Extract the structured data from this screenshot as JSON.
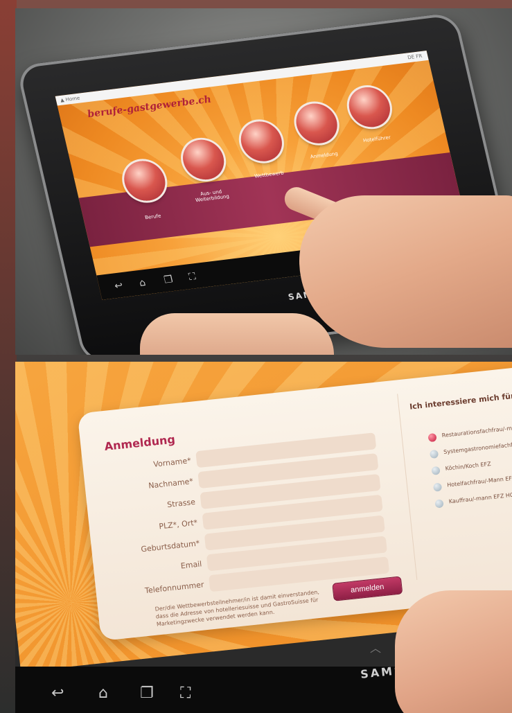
{
  "top_screen": {
    "status_left": "▲ Home",
    "status_right": "DE  FR",
    "logo": "berufe-gastgewerbe.ch",
    "menu": [
      {
        "label": "Berufe"
      },
      {
        "label": "Aus- und Weiterbildung"
      },
      {
        "label": "Wettbewerb"
      },
      {
        "label": "Anmeldung"
      },
      {
        "label": "Hotelführer"
      }
    ],
    "brand": "SAMSUNG"
  },
  "bottom_screen": {
    "form_title": "Anmeldung",
    "fields": [
      {
        "label": "Vorname*",
        "value": ""
      },
      {
        "label": "Nachname*",
        "value": ""
      },
      {
        "label": "Strasse",
        "value": ""
      },
      {
        "label": "PLZ*, Ort*",
        "value": ""
      },
      {
        "label": "Geburtsdatum*",
        "value": ""
      },
      {
        "label": "Email",
        "value": ""
      },
      {
        "label": "Telefonnummer",
        "value": ""
      }
    ],
    "consent_text": "Der/die Wettbewerbsteilnehmer/in ist damit einverstanden, dass die Adresse von hotelleriesuisse und GastroSuisse für Marketingzwecke verwendet werden kann.",
    "submit_label": "anmelden",
    "interest_title": "Ich interessiere mich für folgende/n Be",
    "options": [
      {
        "label": "Restaurationsfachfrau/-mann EFZ",
        "selected": true
      },
      {
        "label": "Systemgastronomiefachfrau/-m",
        "selected": false
      },
      {
        "label": "Köchin/Koch EFZ",
        "selected": false
      },
      {
        "label": "Hotelfachfrau/-Mann EFZ",
        "selected": false
      },
      {
        "label": "Kauffrau/-mann EFZ HGT",
        "selected": false
      }
    ],
    "brand": "SAMSUNG"
  }
}
